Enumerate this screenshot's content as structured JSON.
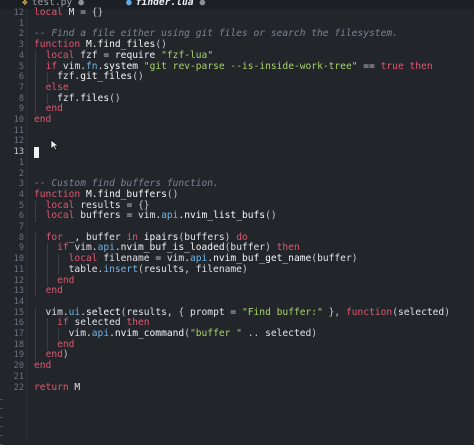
{
  "tabs": [
    {
      "name": "test.py",
      "modified": "●",
      "icon": "python-file-icon",
      "active": false
    },
    {
      "name": "finder.lua",
      "modified": "●",
      "icon": "lua-file-icon",
      "active": true
    }
  ],
  "editor": {
    "current_line": "13",
    "lines": [
      {
        "ln": "12",
        "toks": [
          [
            "kw",
            "local"
          ],
          [
            "id",
            " M "
          ],
          [
            "pun",
            "= {}"
          ]
        ]
      },
      {
        "ln": "1",
        "toks": []
      },
      {
        "ln": "2",
        "toks": [
          [
            "cm",
            "-- Find a file either using git files or search the filesystem."
          ]
        ]
      },
      {
        "ln": "3",
        "toks": [
          [
            "kw",
            "function"
          ],
          [
            "fn",
            " M.find_files"
          ],
          [
            "pun",
            "()"
          ]
        ]
      },
      {
        "ln": "4",
        "toks": [
          [
            "id",
            "  "
          ],
          [
            "kw",
            "local"
          ],
          [
            "id",
            " fzf "
          ],
          [
            "pun",
            "= "
          ],
          [
            "fn",
            "require "
          ],
          [
            "str",
            "\"fzf-lua\""
          ]
        ]
      },
      {
        "ln": "5",
        "toks": [
          [
            "id",
            "  "
          ],
          [
            "kw",
            "if"
          ],
          [
            "id",
            " vim."
          ],
          [
            "api",
            "fn"
          ],
          [
            "id",
            "."
          ],
          [
            "fn",
            "system "
          ],
          [
            "str",
            "\"git rev-parse --is-inside-work-tree\""
          ],
          [
            "pun",
            " == "
          ],
          [
            "bool",
            "true"
          ],
          [
            "kw",
            " then"
          ]
        ]
      },
      {
        "ln": "6",
        "toks": [
          [
            "id",
            "    fzf."
          ],
          [
            "fn",
            "git_files"
          ],
          [
            "pun",
            "()"
          ]
        ]
      },
      {
        "ln": "7",
        "toks": [
          [
            "id",
            "  "
          ],
          [
            "kw",
            "else"
          ]
        ]
      },
      {
        "ln": "8",
        "toks": [
          [
            "id",
            "    fzf."
          ],
          [
            "fn",
            "files"
          ],
          [
            "pun",
            "()"
          ]
        ]
      },
      {
        "ln": "9",
        "toks": [
          [
            "id",
            "  "
          ],
          [
            "kw",
            "end"
          ]
        ]
      },
      {
        "ln": "10",
        "toks": [
          [
            "kw",
            "end"
          ]
        ]
      },
      {
        "ln": "11",
        "toks": []
      },
      {
        "ln": "12",
        "toks": []
      },
      {
        "ln": "13",
        "toks": [],
        "cursor": true
      },
      {
        "ln": "1",
        "toks": []
      },
      {
        "ln": "2",
        "toks": []
      },
      {
        "ln": "3",
        "toks": [
          [
            "cm",
            "-- Custom find buffers function."
          ]
        ]
      },
      {
        "ln": "4",
        "toks": [
          [
            "kw",
            "function"
          ],
          [
            "fn",
            " M.find_buffers"
          ],
          [
            "pun",
            "()"
          ]
        ]
      },
      {
        "ln": "5",
        "toks": [
          [
            "id",
            "  "
          ],
          [
            "kw",
            "local"
          ],
          [
            "id",
            " results "
          ],
          [
            "pun",
            "= {}"
          ]
        ]
      },
      {
        "ln": "6",
        "toks": [
          [
            "id",
            "  "
          ],
          [
            "kw",
            "local"
          ],
          [
            "id",
            " buffers "
          ],
          [
            "pun",
            "= "
          ],
          [
            "id",
            "vim."
          ],
          [
            "api",
            "api"
          ],
          [
            "id",
            "."
          ],
          [
            "fn",
            "nvim_list_bufs"
          ],
          [
            "pun",
            "()"
          ]
        ]
      },
      {
        "ln": "7",
        "toks": []
      },
      {
        "ln": "8",
        "toks": [
          [
            "id",
            "  "
          ],
          [
            "kw",
            "for"
          ],
          [
            "id",
            " _, buffer "
          ],
          [
            "kw",
            "in"
          ],
          [
            "fn",
            " ipairs"
          ],
          [
            "pun",
            "("
          ],
          [
            "id",
            "buffers"
          ],
          [
            "pun",
            ")"
          ],
          [
            "kw",
            " do"
          ]
        ]
      },
      {
        "ln": "9",
        "toks": [
          [
            "id",
            "    "
          ],
          [
            "kw",
            "if"
          ],
          [
            "id",
            " vim."
          ],
          [
            "api",
            "api"
          ],
          [
            "id",
            "."
          ],
          [
            "fn",
            "nvim_buf_is_loaded"
          ],
          [
            "pun",
            "("
          ],
          [
            "id",
            "buffer"
          ],
          [
            "pun",
            ")"
          ],
          [
            "kw",
            " then"
          ]
        ]
      },
      {
        "ln": "10",
        "toks": [
          [
            "id",
            "      "
          ],
          [
            "kw",
            "local"
          ],
          [
            "id",
            " filename "
          ],
          [
            "pun",
            "= "
          ],
          [
            "id",
            "vim."
          ],
          [
            "api",
            "api"
          ],
          [
            "id",
            "."
          ],
          [
            "fn",
            "nvim_buf_get_name"
          ],
          [
            "pun",
            "("
          ],
          [
            "id",
            "buffer"
          ],
          [
            "pun",
            ")"
          ]
        ]
      },
      {
        "ln": "11",
        "toks": [
          [
            "id",
            "      table."
          ],
          [
            "api",
            "insert"
          ],
          [
            "pun",
            "("
          ],
          [
            "id",
            "results, filename"
          ],
          [
            "pun",
            ")"
          ]
        ]
      },
      {
        "ln": "12",
        "toks": [
          [
            "id",
            "    "
          ],
          [
            "kw",
            "end"
          ]
        ]
      },
      {
        "ln": "13",
        "toks": [
          [
            "id",
            "  "
          ],
          [
            "kw",
            "end"
          ]
        ]
      },
      {
        "ln": "14",
        "toks": []
      },
      {
        "ln": "15",
        "toks": [
          [
            "id",
            "  vim."
          ],
          [
            "api",
            "ui"
          ],
          [
            "id",
            "."
          ],
          [
            "fn",
            "select"
          ],
          [
            "pun",
            "("
          ],
          [
            "id",
            "results, "
          ],
          [
            "pun",
            "{ "
          ],
          [
            "id",
            "prompt "
          ],
          [
            "pun",
            "= "
          ],
          [
            "str",
            "\"Find buffer:\""
          ],
          [
            "pun",
            " }, "
          ],
          [
            "kw",
            "function"
          ],
          [
            "pun",
            "("
          ],
          [
            "id",
            "selected"
          ],
          [
            "pun",
            ")"
          ]
        ]
      },
      {
        "ln": "16",
        "toks": [
          [
            "id",
            "    "
          ],
          [
            "kw",
            "if"
          ],
          [
            "id",
            " selected "
          ],
          [
            "kw",
            "then"
          ]
        ]
      },
      {
        "ln": "17",
        "toks": [
          [
            "id",
            "      vim."
          ],
          [
            "api",
            "api"
          ],
          [
            "id",
            "."
          ],
          [
            "fn",
            "nvim_command"
          ],
          [
            "pun",
            "("
          ],
          [
            "str",
            "\"buffer \""
          ],
          [
            "pun",
            " .. "
          ],
          [
            "id",
            "selected"
          ],
          [
            "pun",
            ")"
          ]
        ]
      },
      {
        "ln": "18",
        "toks": [
          [
            "id",
            "    "
          ],
          [
            "kw",
            "end"
          ]
        ]
      },
      {
        "ln": "19",
        "toks": [
          [
            "id",
            "  "
          ],
          [
            "kw",
            "end"
          ],
          [
            "pun",
            ")"
          ]
        ]
      },
      {
        "ln": "20",
        "toks": [
          [
            "kw",
            "end"
          ]
        ]
      },
      {
        "ln": "21",
        "toks": []
      },
      {
        "ln": "22",
        "toks": [
          [
            "kw",
            "return"
          ],
          [
            "id",
            " M"
          ]
        ]
      }
    ]
  },
  "colors": {
    "background": "#22262b",
    "keyword": "#e0576f",
    "comment": "#7b8491",
    "string": "#a7d26b",
    "api": "#6fb4e6"
  }
}
